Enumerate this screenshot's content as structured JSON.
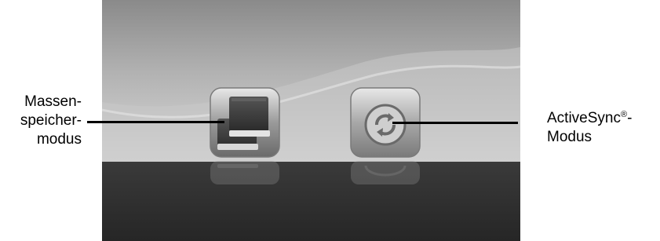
{
  "screen": {
    "background_top": "#a8a8a8",
    "background_bottom": "#2e2e2e"
  },
  "buttons": [
    {
      "id": "mass-storage",
      "icon": "drive-stack-icon",
      "label_lines": [
        "Massen-",
        "speicher-",
        "modus"
      ]
    },
    {
      "id": "activesync",
      "icon": "sync-arrows-icon",
      "label_main": "ActiveSync",
      "label_reg": "®",
      "label_suffix": "-",
      "label_line2": "Modus"
    }
  ]
}
